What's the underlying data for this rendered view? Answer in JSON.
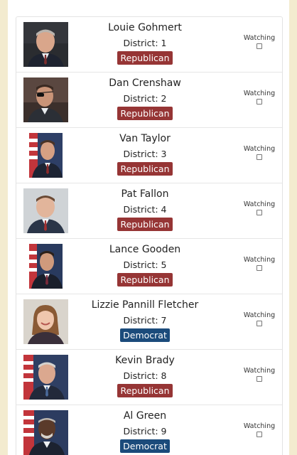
{
  "watching_label": "Watching",
  "colors": {
    "page_background": "#f3ebcf",
    "republican": "#963535",
    "democrat": "#1b4b7b"
  },
  "representatives": [
    {
      "name": "Louie Gohmert",
      "district": "District: 1",
      "party": "Republican",
      "watching": false,
      "photo": "portrait-photo"
    },
    {
      "name": "Dan Crenshaw",
      "district": "District: 2",
      "party": "Republican",
      "watching": false,
      "photo": "portrait-photo"
    },
    {
      "name": "Van Taylor",
      "district": "District: 3",
      "party": "Republican",
      "watching": false,
      "photo": "portrait-photo-with-flag"
    },
    {
      "name": "Pat Fallon",
      "district": "District: 4",
      "party": "Republican",
      "watching": false,
      "photo": "portrait-photo"
    },
    {
      "name": "Lance Gooden",
      "district": "District: 5",
      "party": "Republican",
      "watching": false,
      "photo": "portrait-photo-with-flag"
    },
    {
      "name": "Lizzie Pannill Fletcher",
      "district": "District: 7",
      "party": "Democrat",
      "watching": false,
      "photo": "portrait-photo"
    },
    {
      "name": "Kevin Brady",
      "district": "District: 8",
      "party": "Republican",
      "watching": false,
      "photo": "portrait-photo-with-flag"
    },
    {
      "name": "Al Green",
      "district": "District: 9",
      "party": "Democrat",
      "watching": false,
      "photo": "portrait-photo-with-flag"
    }
  ]
}
